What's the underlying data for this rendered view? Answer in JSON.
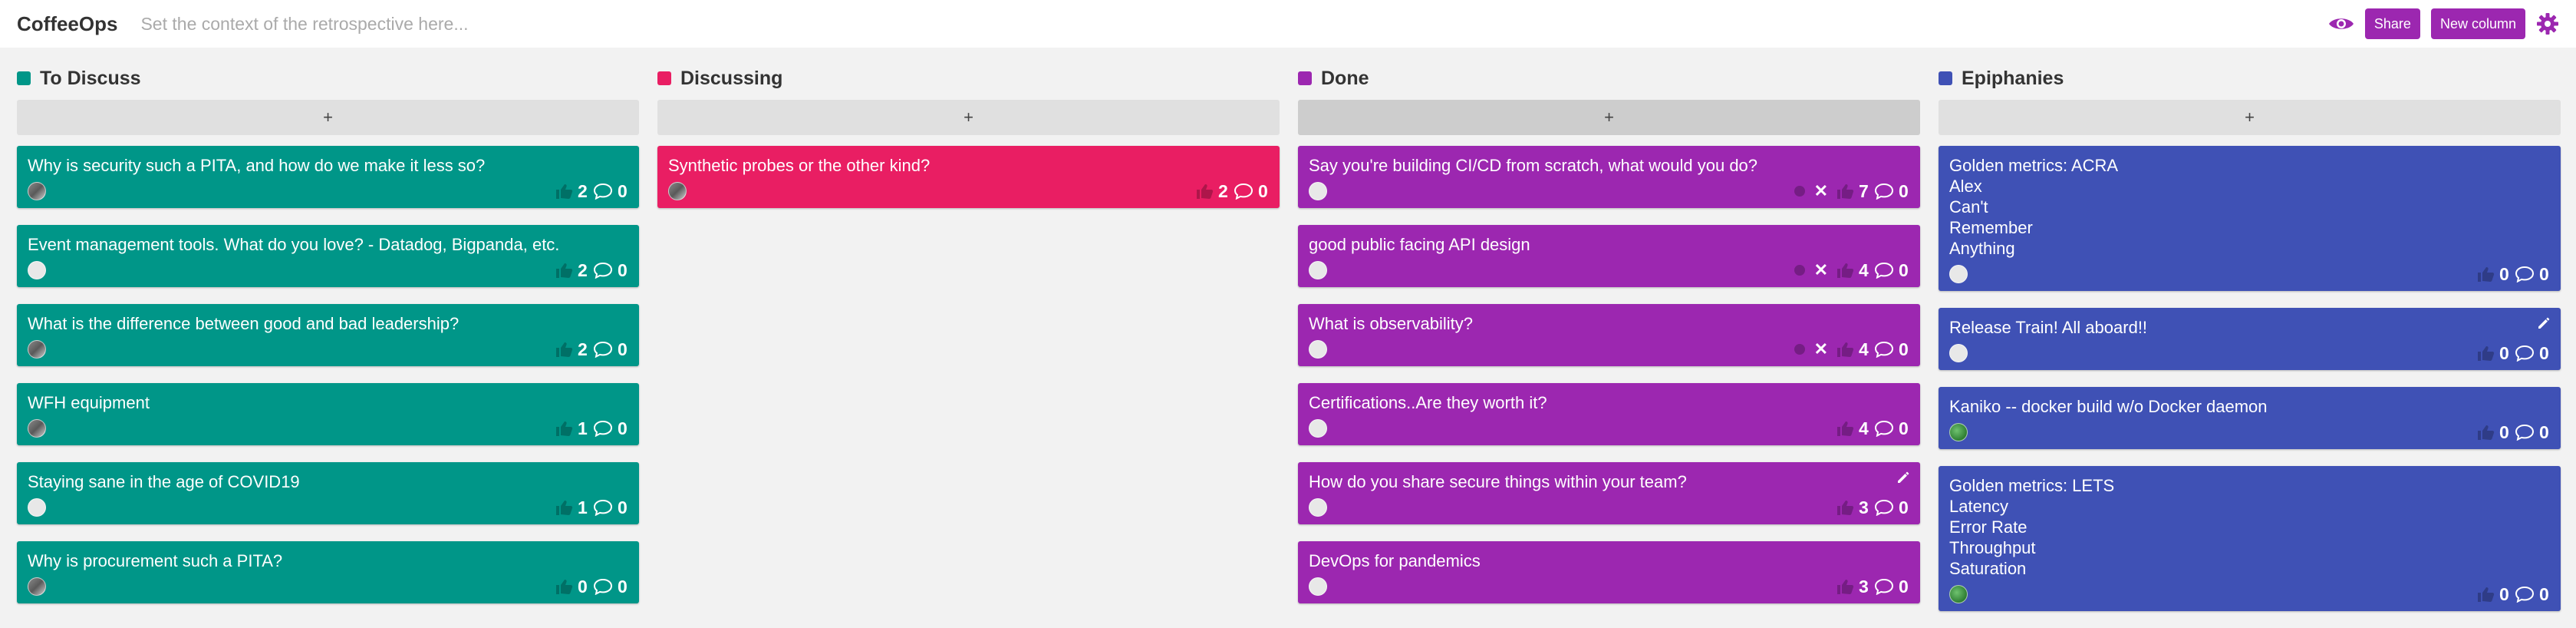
{
  "app": {
    "title": "CoffeeOps",
    "context_placeholder": "Set the context of the retrospective here..."
  },
  "toolbar": {
    "eye_icon": "eye-icon",
    "share_label": "Share",
    "new_column_label": "New column",
    "gear_icon": "gear-icon",
    "accent_color": "#9c27b0"
  },
  "columns": [
    {
      "title": "To Discuss",
      "color": "#009688",
      "add_label": "+",
      "cards": [
        {
          "text": "Why is security such a PITA, and how do we make it less so?",
          "likes": "2",
          "comments": "0"
        },
        {
          "text": "Event management tools. What do you love? - Datadog, Bigpanda, etc.",
          "likes": "2",
          "comments": "0"
        },
        {
          "text": "What is the difference between good and bad leadership?",
          "likes": "2",
          "comments": "0"
        },
        {
          "text": "WFH equipment",
          "likes": "1",
          "comments": "0"
        },
        {
          "text": "Staying sane in the age of COVID19",
          "likes": "1",
          "comments": "0"
        },
        {
          "text": "Why is procurement such a PITA?",
          "likes": "0",
          "comments": "0"
        }
      ]
    },
    {
      "title": "Discussing",
      "color": "#e91e63",
      "add_label": "+",
      "cards": [
        {
          "text": "Synthetic probes or the other kind?",
          "likes": "2",
          "comments": "0"
        }
      ]
    },
    {
      "title": "Done",
      "color": "#9c27b0",
      "add_label": "+",
      "cards": [
        {
          "text": "Say you're building CI/CD from scratch, what would you do?",
          "likes": "7",
          "comments": "0"
        },
        {
          "text": "good public facing API design",
          "likes": "4",
          "comments": "0"
        },
        {
          "text": "What is observability?",
          "likes": "4",
          "comments": "0"
        },
        {
          "text": "Certifications..Are they worth it?",
          "likes": "4",
          "comments": "0"
        },
        {
          "text": "How do you share secure things within your team?",
          "likes": "3",
          "comments": "0"
        },
        {
          "text": "DevOps for pandemics",
          "likes": "3",
          "comments": "0"
        }
      ]
    },
    {
      "title": "Epiphanies",
      "color": "#3f51b5",
      "add_label": "+",
      "cards": [
        {
          "text": "Golden metrics: ACRA\nAlex\nCan't\nRemember\nAnything",
          "likes": "0",
          "comments": "0"
        },
        {
          "text": "Release Train! All aboard!!",
          "likes": "0",
          "comments": "0"
        },
        {
          "text": "Kaniko -- docker build w/o Docker daemon",
          "likes": "0",
          "comments": "0"
        },
        {
          "text": "Golden metrics: LETS\nLatency\nError Rate\nThroughput\nSaturation",
          "likes": "0",
          "comments": "0"
        }
      ]
    }
  ]
}
